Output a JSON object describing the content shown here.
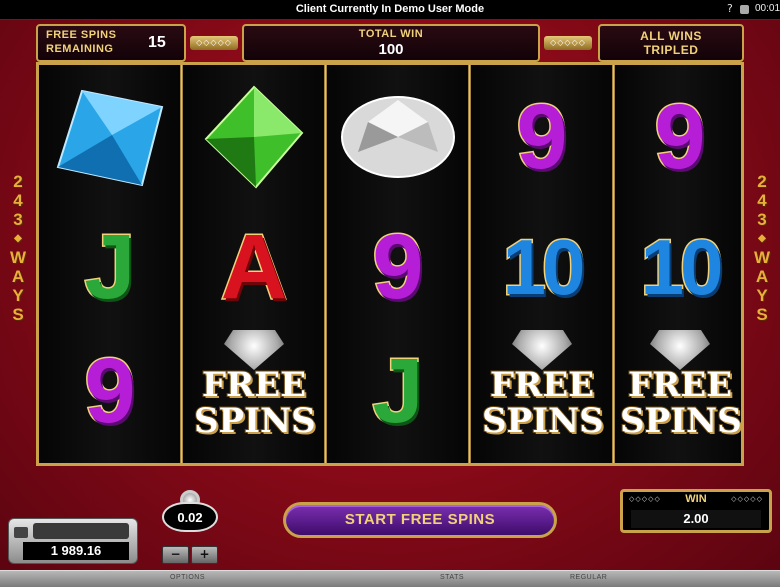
{
  "topbar": {
    "title": "Client Currently In Demo User Mode",
    "help": "?",
    "clock": "00:01"
  },
  "header": {
    "free_spins_label_1": "FREE SPINS",
    "free_spins_label_2": "REMAINING",
    "free_spins_remaining": "15",
    "total_win_label": "TOTAL WIN",
    "total_win_value": "100",
    "all_wins_1": "ALL WINS",
    "all_wins_2": "TRIPLED"
  },
  "ways_text": [
    "2",
    "4",
    "3",
    "W",
    "A",
    "Y",
    "S"
  ],
  "reels": [
    [
      "blue-gem",
      "J",
      "9"
    ],
    [
      "green-gem",
      "A",
      "FREE SPINS"
    ],
    [
      "white-diamond",
      "9",
      "J"
    ],
    [
      "9",
      "10",
      "FREE SPINS"
    ],
    [
      "9",
      "10",
      "FREE SPINS"
    ]
  ],
  "free_spins_word_1": "FREE",
  "free_spins_word_2": "SPINS",
  "balance": {
    "value": "1 989.16"
  },
  "coin": {
    "value": "0.02",
    "minus": "−",
    "plus": "+"
  },
  "start_button": {
    "label": "START FREE SPINS"
  },
  "win": {
    "label": "WIN",
    "value": "2.00"
  },
  "bottombar": {
    "options": "OPTIONS",
    "stats": "STATS",
    "regular": "REGULAR"
  },
  "colors": {
    "felt": "#8a0a18",
    "gold": "#c9a24a",
    "nine": "#b51ed6",
    "ten": "#1e86e0",
    "jack": "#2aa83a",
    "ace": "#d8121e"
  }
}
